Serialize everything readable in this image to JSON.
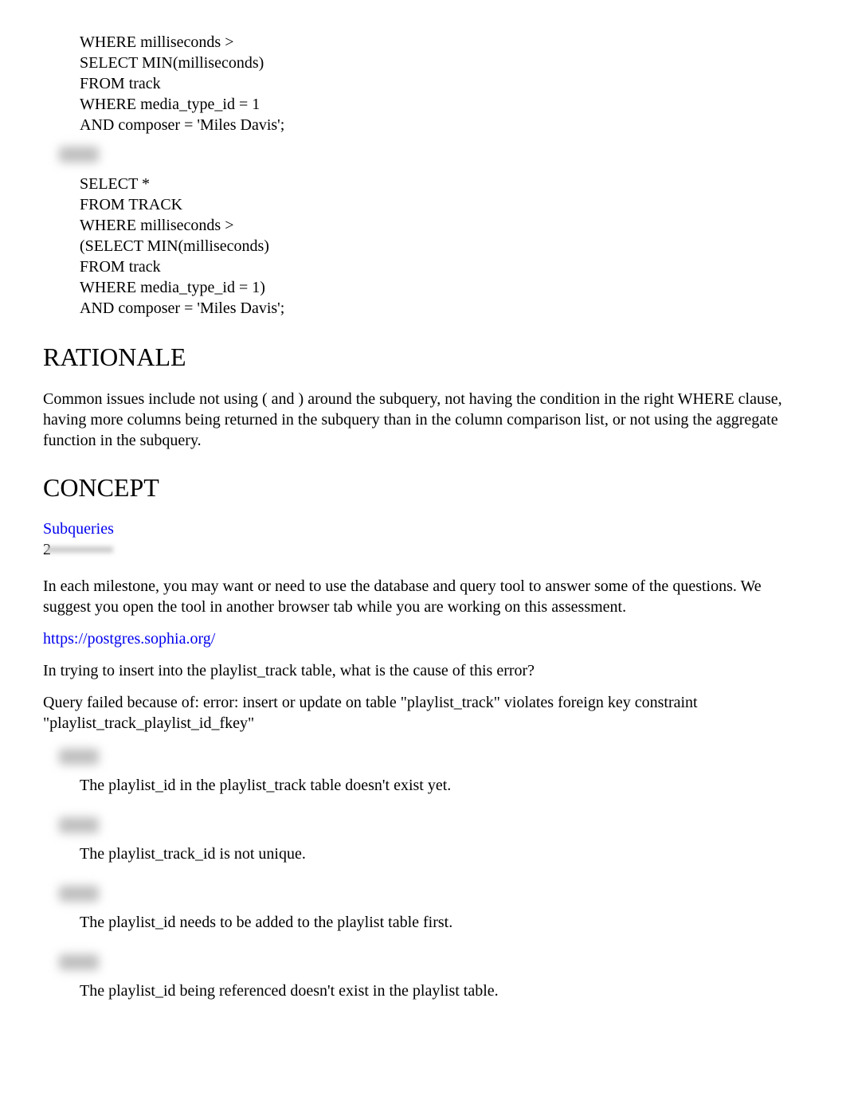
{
  "codeblock1": {
    "l1": "WHERE milliseconds >",
    "l2": "SELECT MIN(milliseconds)",
    "l3": "FROM track",
    "l4": "WHERE media_type_id = 1",
    "l5": "AND composer = 'Miles Davis';"
  },
  "codeblock2": {
    "l1": "SELECT *",
    "l2": "FROM TRACK",
    "l3": "WHERE milliseconds >",
    "l4": "(SELECT MIN(milliseconds)",
    "l5": "FROM track",
    "l6": "WHERE media_type_id = 1)",
    "l7": "AND composer = 'Miles Davis';"
  },
  "headings": {
    "rationale": "RATIONALE",
    "concept": "CONCEPT"
  },
  "rationale_text": "Common issues include not using ( and ) around the subquery, not having the condition in the right WHERE clause, having more columns being returned in the subquery than in the column comparison list, or not using the aggregate function in the subquery.",
  "concept_link": "Subqueries",
  "question_number": "2",
  "milestone_text": "In each milestone, you may want or need to use the database and query tool to answer some of the questions. We suggest you open the tool in another browser tab while you are working on this assessment.",
  "tool_link": "https://postgres.sophia.org/",
  "question_text": "In trying to insert into the playlist_track table, what is the cause of this error?",
  "error_text": "Query failed because of: error: insert or update on table \"playlist_track\" violates foreign key constraint \"playlist_track_playlist_id_fkey\"",
  "answers": {
    "a": "The playlist_id in the playlist_track table doesn't exist yet.",
    "b": "The playlist_track_id is not unique.",
    "c": "The playlist_id needs to be added to the playlist table first.",
    "d": "The playlist_id being referenced doesn't exist in the playlist table."
  }
}
